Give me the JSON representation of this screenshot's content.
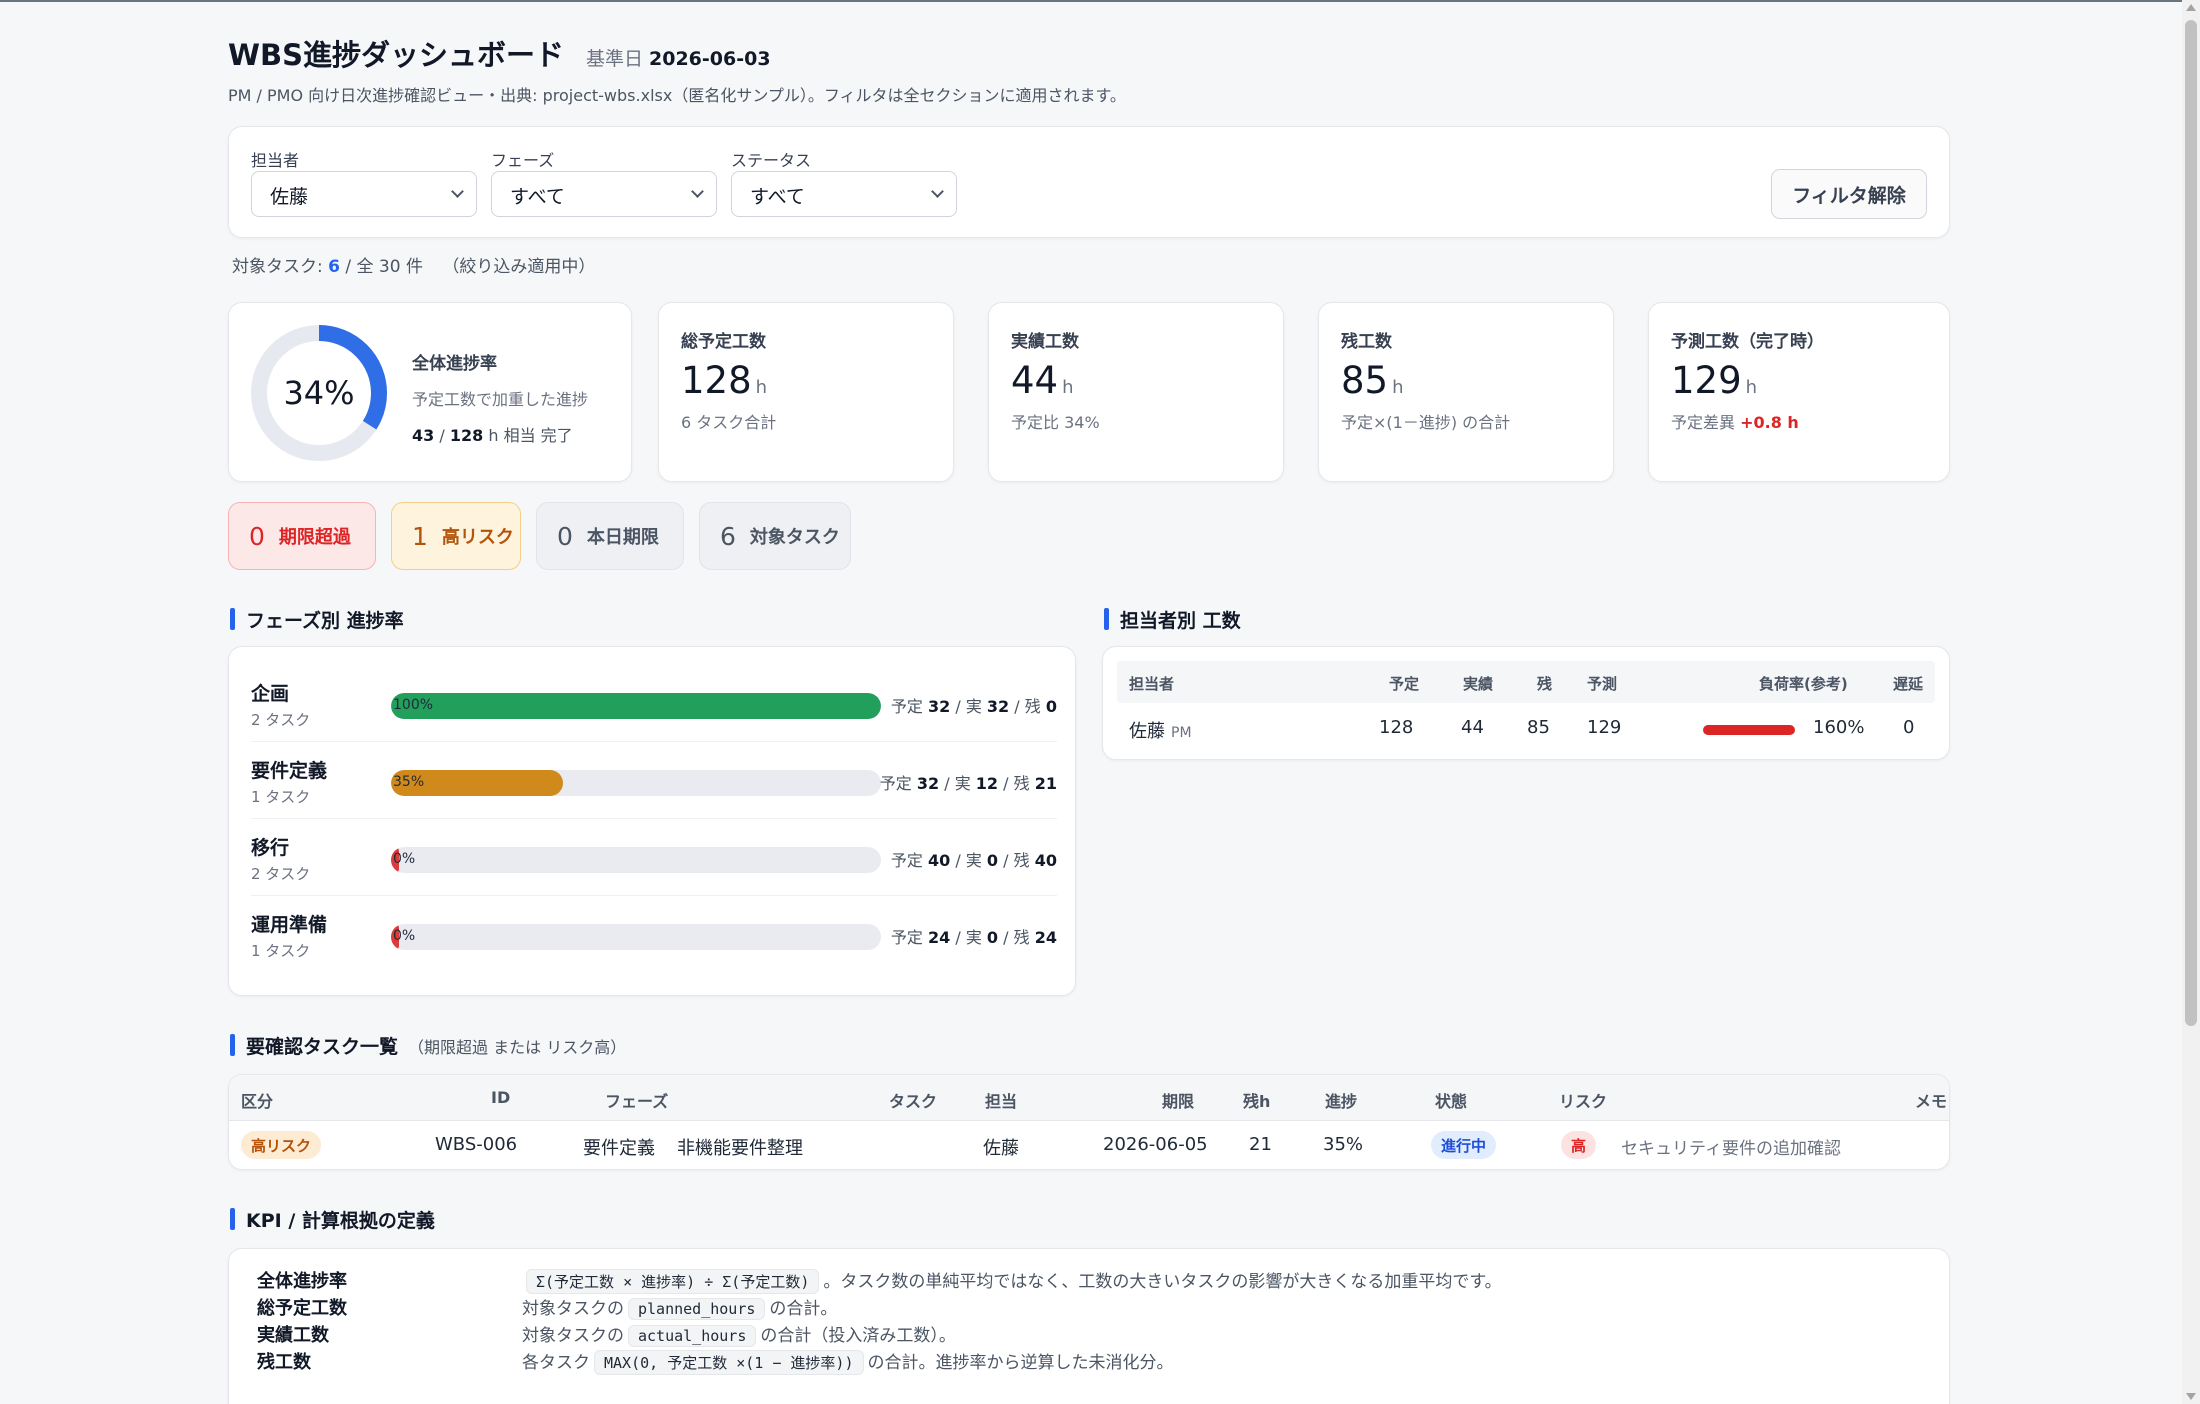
{
  "header": {
    "title": "WBS進捗ダッシュボード",
    "date_label": "基準日",
    "date_value": "2026-06-03",
    "subtitle": "PM / PMO 向け日次進捗確認ビュー・出典: project-wbs.xlsx（匿名化サンプル）。フィルタは全セクションに適用されます。"
  },
  "filters": {
    "owner": {
      "label": "担当者",
      "value": "佐藤"
    },
    "phase": {
      "label": "フェーズ",
      "value": "すべて"
    },
    "status": {
      "label": "ステータス",
      "value": "すべて"
    },
    "clear_label": "フィルタ解除"
  },
  "target": {
    "prefix": "対象タスク:",
    "count": "6",
    "total": "/ 全 30 件",
    "note": "（絞り込み適用中）"
  },
  "progress": {
    "percent": 34,
    "percent_label": "34%",
    "title": "全体進捗率",
    "sub": "予定工数で加重した進捗",
    "done": "43",
    "sep": "/",
    "total": "128",
    "unit": "h",
    "suffix": "相当 完了"
  },
  "kpis": [
    {
      "label": "総予定工数",
      "value": "128",
      "unit": "h",
      "note": "6 タスク合計",
      "delta": ""
    },
    {
      "label": "実績工数",
      "value": "44",
      "unit": "h",
      "note": "予定比 34%",
      "delta": ""
    },
    {
      "label": "残工数",
      "value": "85",
      "unit": "h",
      "note": "予定×(1－進捗) の合計",
      "delta": ""
    },
    {
      "label": "予測工数（完了時）",
      "value": "129",
      "unit": "h",
      "note": "予定差異",
      "delta": "+0.8 h"
    }
  ],
  "badges": [
    {
      "count": "0",
      "label": "期限超過"
    },
    {
      "count": "1",
      "label": "高リスク"
    },
    {
      "count": "0",
      "label": "本日期限"
    },
    {
      "count": "6",
      "label": "対象タスク"
    }
  ],
  "phase_section": {
    "title": "フェーズ別 進捗率",
    "stat_labels": {
      "plan": "予定",
      "actual": "実",
      "remain": "残"
    },
    "phases": [
      {
        "name": "企画",
        "count": "2 タスク",
        "progress": 100,
        "pct_label": "100%",
        "plan": "32",
        "actual": "32",
        "remain": "0",
        "color": "#22a05b"
      },
      {
        "name": "要件定義",
        "count": "1 タスク",
        "progress": 35,
        "pct_label": "35%",
        "plan": "32",
        "actual": "12",
        "remain": "21",
        "color": "#d08a1c"
      },
      {
        "name": "移行",
        "count": "2 タスク",
        "progress": 0,
        "pct_label": "0%",
        "plan": "40",
        "actual": "0",
        "remain": "40",
        "color": "#dc3b3b"
      },
      {
        "name": "運用準備",
        "count": "1 タスク",
        "progress": 0,
        "pct_label": "0%",
        "plan": "24",
        "actual": "0",
        "remain": "24",
        "color": "#dc3b3b"
      }
    ]
  },
  "owner_section": {
    "title": "担当者別 工数",
    "headers": [
      "担当者",
      "予定",
      "実績",
      "残",
      "予測",
      "負荷率(参考)",
      "遅延"
    ],
    "rows": [
      {
        "name": "佐藤",
        "role": "PM",
        "plan": "128",
        "actual": "44",
        "remain": "85",
        "forecast": "129",
        "load": 160,
        "load_label": "160%",
        "delay": "0"
      }
    ]
  },
  "task_section": {
    "title": "要確認タスク一覧",
    "subtitle": "（期限超過 または リスク高）",
    "headers": [
      "区分",
      "ID",
      "フェーズ",
      "タスク",
      "担当",
      "期限",
      "残h",
      "進捗",
      "状態",
      "リスク",
      "メモ"
    ],
    "rows": [
      {
        "category": "高リスク",
        "id": "WBS-006",
        "phase": "要件定義",
        "task": "非機能要件整理",
        "owner": "佐藤",
        "due": "2026-06-05",
        "remain": "21",
        "progress": "35%",
        "status": "進行中",
        "risk": "高",
        "memo": "セキュリティ要件の追加確認"
      }
    ]
  },
  "definitions": {
    "title": "KPI / 計算根拠の定義",
    "items": [
      {
        "term": "全体進捗率",
        "pre": "",
        "code": "Σ(予定工数 × 進捗率) ÷ Σ(予定工数)",
        "post": "。タスク数の単純平均ではなく、工数の大きいタスクの影響が大きくなる加重平均です。"
      },
      {
        "term": "総予定工数",
        "pre": "対象タスクの",
        "code": "planned_hours",
        "post": "の合計。"
      },
      {
        "term": "実績工数",
        "pre": "対象タスクの",
        "code": "actual_hours",
        "post": "の合計（投入済み工数）。"
      },
      {
        "term": "残工数",
        "pre": "各タスク",
        "code": "MAX(0, 予定工数 ×(1 − 進捗率))",
        "post": "の合計。進捗率から逆算した未消化分。"
      }
    ]
  },
  "colors": {
    "accent": "#2563eb",
    "donut_track": "#e6e9f0",
    "donut_fill": "#2f6ee6",
    "danger": "#dc2626",
    "warning": "#b45309"
  }
}
